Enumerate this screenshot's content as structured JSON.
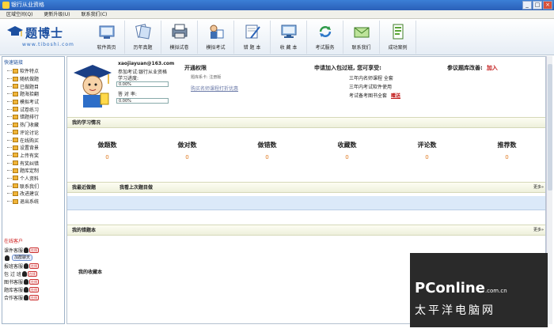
{
  "window": {
    "title": "银行从业资格"
  },
  "menu": [
    "区域空间(Q)",
    "更新升级(U)",
    "联系我们(C)"
  ],
  "logo": {
    "brand": "题博士",
    "url": "www.tiboshi.com"
  },
  "toolbar": [
    {
      "label": "软件首页",
      "icon": "home-icon"
    },
    {
      "label": "历年真题",
      "icon": "exam-papers-icon"
    },
    {
      "label": "模拟试卷",
      "icon": "mock-paper-icon"
    },
    {
      "label": "模拟考试",
      "icon": "mock-exam-icon"
    },
    {
      "label": "错 题 本",
      "icon": "wrong-book-icon"
    },
    {
      "label": "收 藏 本",
      "icon": "favorites-icon"
    },
    {
      "label": "考试服务",
      "icon": "exam-service-icon"
    },
    {
      "label": "联系我们",
      "icon": "contact-icon"
    },
    {
      "label": "成功案例",
      "icon": "success-case-icon"
    }
  ],
  "sidebar": {
    "header": "快速链接",
    "items": [
      "软件特点",
      "随机做题",
      "已做题目",
      "题海拾翻",
      "模拟考试",
      "试卷练习",
      "错题排行",
      "热门收藏",
      "评论讨论",
      "在线购买",
      "设置背景",
      "上传有奖",
      "有奖纠错",
      "题库定制",
      "个人资料",
      "联系我们",
      "改进建议",
      "退出系统"
    ],
    "service_title": "在线客户",
    "service": [
      {
        "label": "课件客服",
        "badge": "在线"
      },
      {
        "label": "加入群",
        "group": "加群聊天"
      },
      {
        "label": "报班客服",
        "badge": "在线"
      },
      {
        "label": "包 过 班",
        "badge": "在线"
      },
      {
        "label": "图书客服",
        "badge": "在线"
      },
      {
        "label": "题库客服",
        "badge": "在线"
      },
      {
        "label": "合作客服",
        "badge": "在线"
      }
    ]
  },
  "profile": {
    "email": "xaojiayuan@163.com",
    "exam": "参加考试:银行从业资格",
    "progress_label": "学习进度:",
    "progress_value": "0.00%",
    "accuracy_label": "答 对 率:",
    "accuracy_value": "0.00%"
  },
  "permission": {
    "title": "开通权限",
    "tiku_label": "题库系卡: 注册版",
    "link": "购买名师课程打折优惠"
  },
  "free": {
    "title": "申请加入包过班, 您可享受:",
    "items": [
      "三年内名师课程 全套",
      "三年内考试软件使用",
      "考试备考图书全套"
    ],
    "gift": "赠送"
  },
  "tiku_change": {
    "title": "参议题库改善:",
    "join": "加入"
  },
  "sections": {
    "my_learning": "我的学习情况",
    "recent": "我最近做题",
    "last_view": "我看上次题目做",
    "wrong_book": "我的错题本",
    "favorites": "我的收藏本",
    "more": "更多»"
  },
  "stats": [
    {
      "label": "做题数",
      "value": "0"
    },
    {
      "label": "做对数",
      "value": "0"
    },
    {
      "label": "做错数",
      "value": "0"
    },
    {
      "label": "收藏数",
      "value": "0"
    },
    {
      "label": "评论数",
      "value": "0"
    },
    {
      "label": "推荐数",
      "value": "0"
    }
  ],
  "watermark": {
    "brand": "PConline",
    "domain": ".com.cn",
    "cn": "太平洋电脑网"
  }
}
